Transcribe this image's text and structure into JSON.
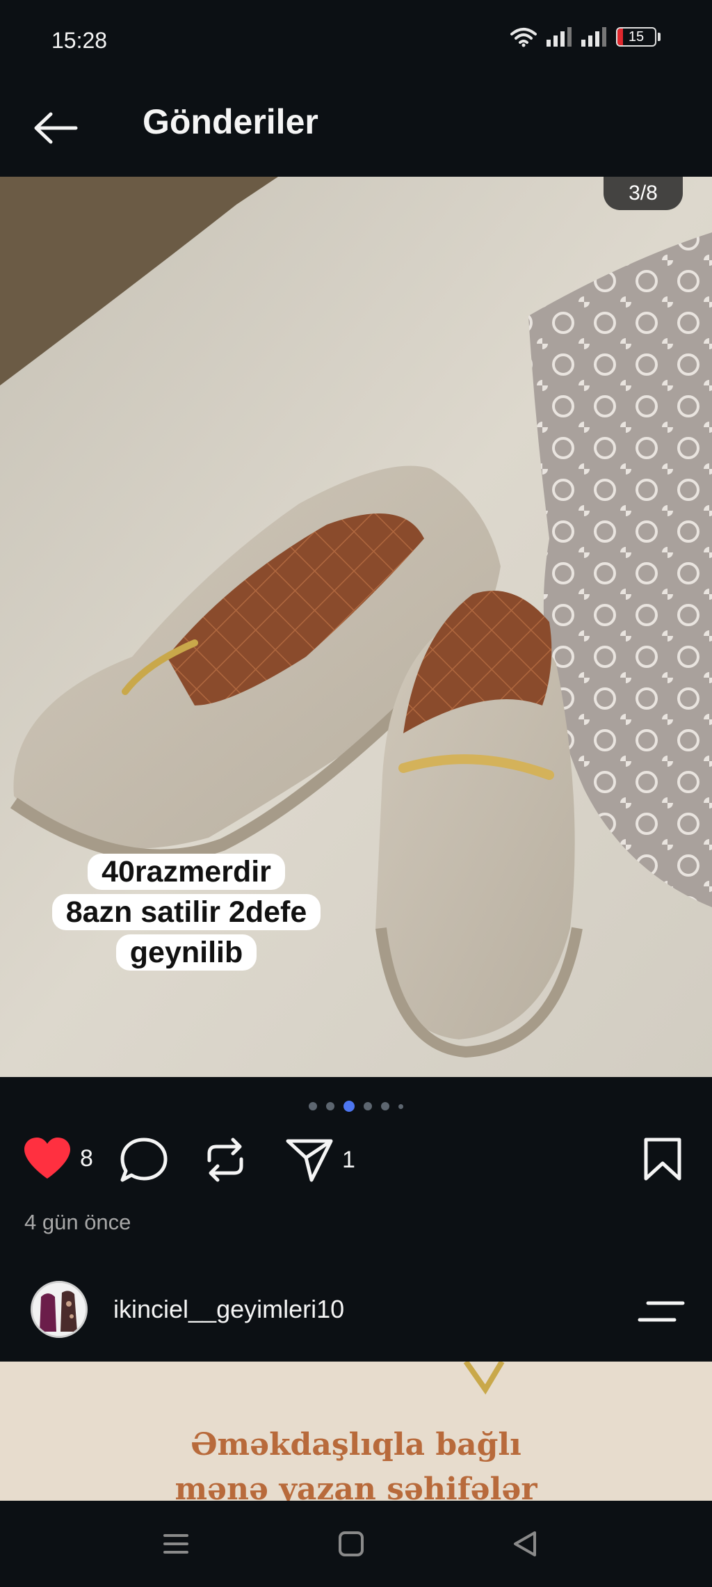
{
  "status_bar": {
    "time": "15:28",
    "battery_level": "15",
    "battery_fraction": 0.15,
    "icons": [
      "wifi-icon",
      "signal-icon",
      "signal-icon",
      "battery-icon"
    ]
  },
  "header": {
    "back_icon": "arrow-left-icon",
    "title": "Gönderiler"
  },
  "post": {
    "image_counter": "3/8",
    "caption_lines": [
      "40razmerdir",
      "8azn satilir 2defe",
      "geynilib"
    ],
    "carousel": {
      "dots": 6,
      "active_index": 2
    },
    "likes": "8",
    "shares": "1",
    "liked": true,
    "time_ago": "4 gün önce"
  },
  "account": {
    "username": "ikinciel__geyimleri10"
  },
  "next_post": {
    "text_lines": [
      "Əməkdaşlıqla bağlı",
      "mənə yazan səhifələr"
    ]
  },
  "colors": {
    "background": "#0c1014",
    "like_red": "#ff3040",
    "active_dot": "#4d76f1",
    "next_post_bg": "#e7dccd",
    "next_post_text": "#b86a3b"
  }
}
